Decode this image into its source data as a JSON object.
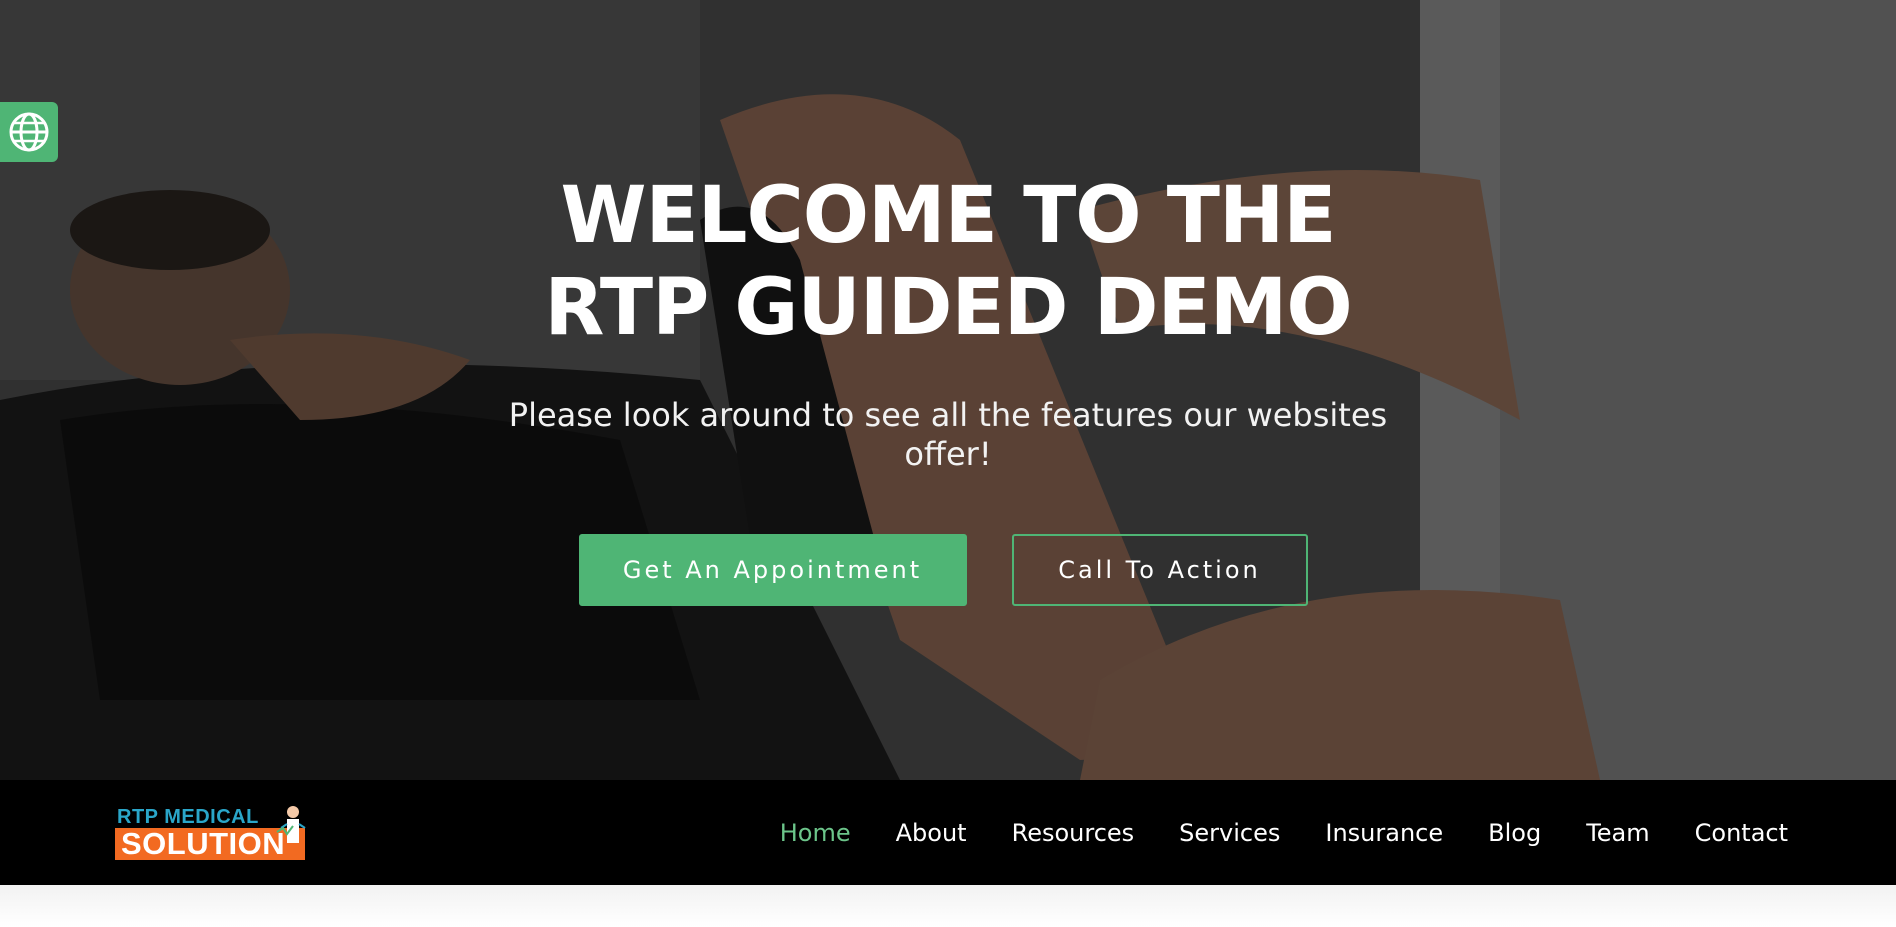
{
  "hero": {
    "title_line1": "WELCOME TO THE",
    "title_line2": "RTP GUIDED DEMO",
    "subtitle": "Please look around to see all the features our websites offer!",
    "primary_button": "Get An Appointment",
    "secondary_button": "Call To Action"
  },
  "language_button": {
    "icon": "globe-icon"
  },
  "logo": {
    "top_text": "RTP MEDICAL",
    "bottom_text": "SOLUTION"
  },
  "nav": {
    "items": [
      {
        "label": "Home",
        "active": true
      },
      {
        "label": "About"
      },
      {
        "label": "Resources"
      },
      {
        "label": "Services"
      },
      {
        "label": "Insurance"
      },
      {
        "label": "Blog"
      },
      {
        "label": "Team"
      },
      {
        "label": "Contact"
      }
    ]
  },
  "colors": {
    "accent": "#4fb575",
    "nav_background": "#000000",
    "nav_active": "#6cc58a",
    "logo_blue": "#2aa6c9",
    "logo_orange": "#f26a21"
  }
}
